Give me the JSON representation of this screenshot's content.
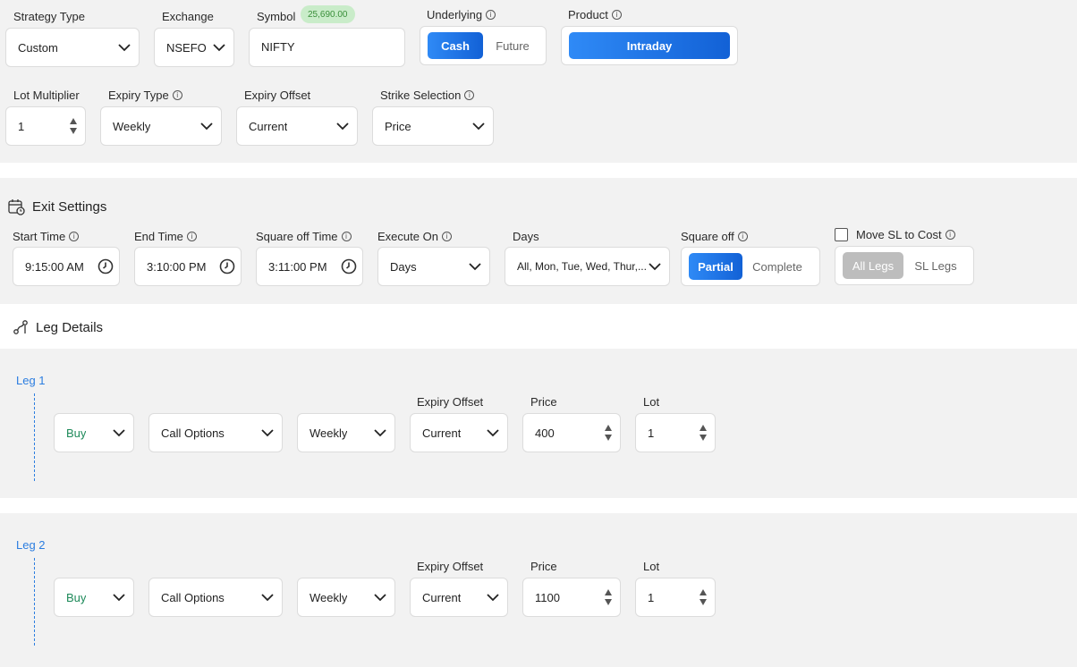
{
  "strategy": {
    "strategy_type": {
      "label": "Strategy Type",
      "value": "Custom"
    },
    "exchange": {
      "label": "Exchange",
      "value": "NSEFO"
    },
    "symbol": {
      "label": "Symbol",
      "value": "NIFTY",
      "badge": "25,690.00"
    },
    "underlying": {
      "label": "Underlying",
      "options": [
        "Cash",
        "Future"
      ],
      "selected": "Cash"
    },
    "product": {
      "label": "Product",
      "value": "Intraday"
    },
    "lot_multiplier": {
      "label": "Lot Multiplier",
      "value": "1"
    },
    "expiry_type": {
      "label": "Expiry Type",
      "value": "Weekly"
    },
    "expiry_offset": {
      "label": "Expiry Offset",
      "value": "Current"
    },
    "strike_selection": {
      "label": "Strike Selection",
      "value": "Price"
    }
  },
  "exit": {
    "title": "Exit Settings",
    "start_time": {
      "label": "Start Time",
      "value": "9:15:00 AM"
    },
    "end_time": {
      "label": "End Time",
      "value": "3:10:00 PM"
    },
    "square_off_time": {
      "label": "Square off Time",
      "value": "3:11:00 PM"
    },
    "execute_on": {
      "label": "Execute On",
      "value": "Days"
    },
    "days": {
      "label": "Days",
      "value": "All, Mon, Tue, Wed, Thur,..."
    },
    "square_off": {
      "label": "Square off",
      "options": [
        "Partial",
        "Complete"
      ],
      "selected": "Partial"
    },
    "move_sl": {
      "label": "Move SL to Cost",
      "checked": false,
      "options": [
        "All Legs",
        "SL Legs"
      ]
    }
  },
  "legs_title": "Leg Details",
  "legs": [
    {
      "name": "Leg 1",
      "side": "Buy",
      "option_type": "Call Options",
      "expiry": "Weekly",
      "expiry_offset_label": "Expiry Offset",
      "expiry_offset": "Current",
      "price_label": "Price",
      "price": "400",
      "lot_label": "Lot",
      "lot": "1"
    },
    {
      "name": "Leg 2",
      "side": "Buy",
      "option_type": "Call Options",
      "expiry": "Weekly",
      "expiry_offset_label": "Expiry Offset",
      "expiry_offset": "Current",
      "price_label": "Price",
      "price": "1100",
      "lot_label": "Lot",
      "lot": "1"
    }
  ],
  "colors": {
    "accent": "#1f75eb",
    "leg": "#2b7de0",
    "buy": "#1e8a5a",
    "badge_bg": "#c9ecc9"
  }
}
